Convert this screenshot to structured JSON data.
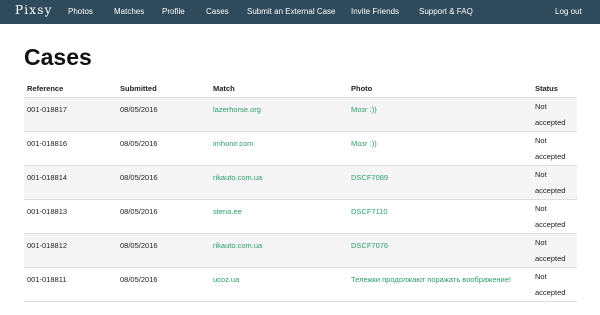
{
  "brand": "Pixsy",
  "nav": {
    "photos": "Photos",
    "matches": "Matches",
    "profile": "Profile",
    "cases": "Cases",
    "submit": "Submit an External Case",
    "invite": "Invite Friends",
    "support": "Support & FAQ",
    "logout": "Log out"
  },
  "page_title": "Cases",
  "table": {
    "headers": {
      "reference": "Reference",
      "submitted": "Submitted",
      "match": "Match",
      "photo": "Photo",
      "status": "Status"
    },
    "rows": [
      {
        "reference": "001-018817",
        "submitted": "08/05/2016",
        "match": "lazerhorse.org",
        "photo": "Мозг :))",
        "status": "Not accepted"
      },
      {
        "reference": "001-018816",
        "submitted": "08/05/2016",
        "match": "imhonir.com",
        "photo": "Мозг :))",
        "status": "Not accepted"
      },
      {
        "reference": "001-018814",
        "submitted": "08/05/2016",
        "match": "rikauto.com.ua",
        "photo": "DSCF7089",
        "status": "Not accepted"
      },
      {
        "reference": "001-018813",
        "submitted": "08/05/2016",
        "match": "stena.ee",
        "photo": "DSCF7110",
        "status": "Not accepted"
      },
      {
        "reference": "001-018812",
        "submitted": "08/05/2016",
        "match": "rikauto.com.ua",
        "photo": "DSCF7076",
        "status": "Not accepted"
      },
      {
        "reference": "001-018811",
        "submitted": "08/05/2016",
        "match": "ucoz.ua",
        "photo": "Тележки продолжают поражать воображение!",
        "status": "Not accepted"
      }
    ]
  },
  "colors": {
    "navbar": "#2f4a5b",
    "link": "#2a9d6a"
  }
}
